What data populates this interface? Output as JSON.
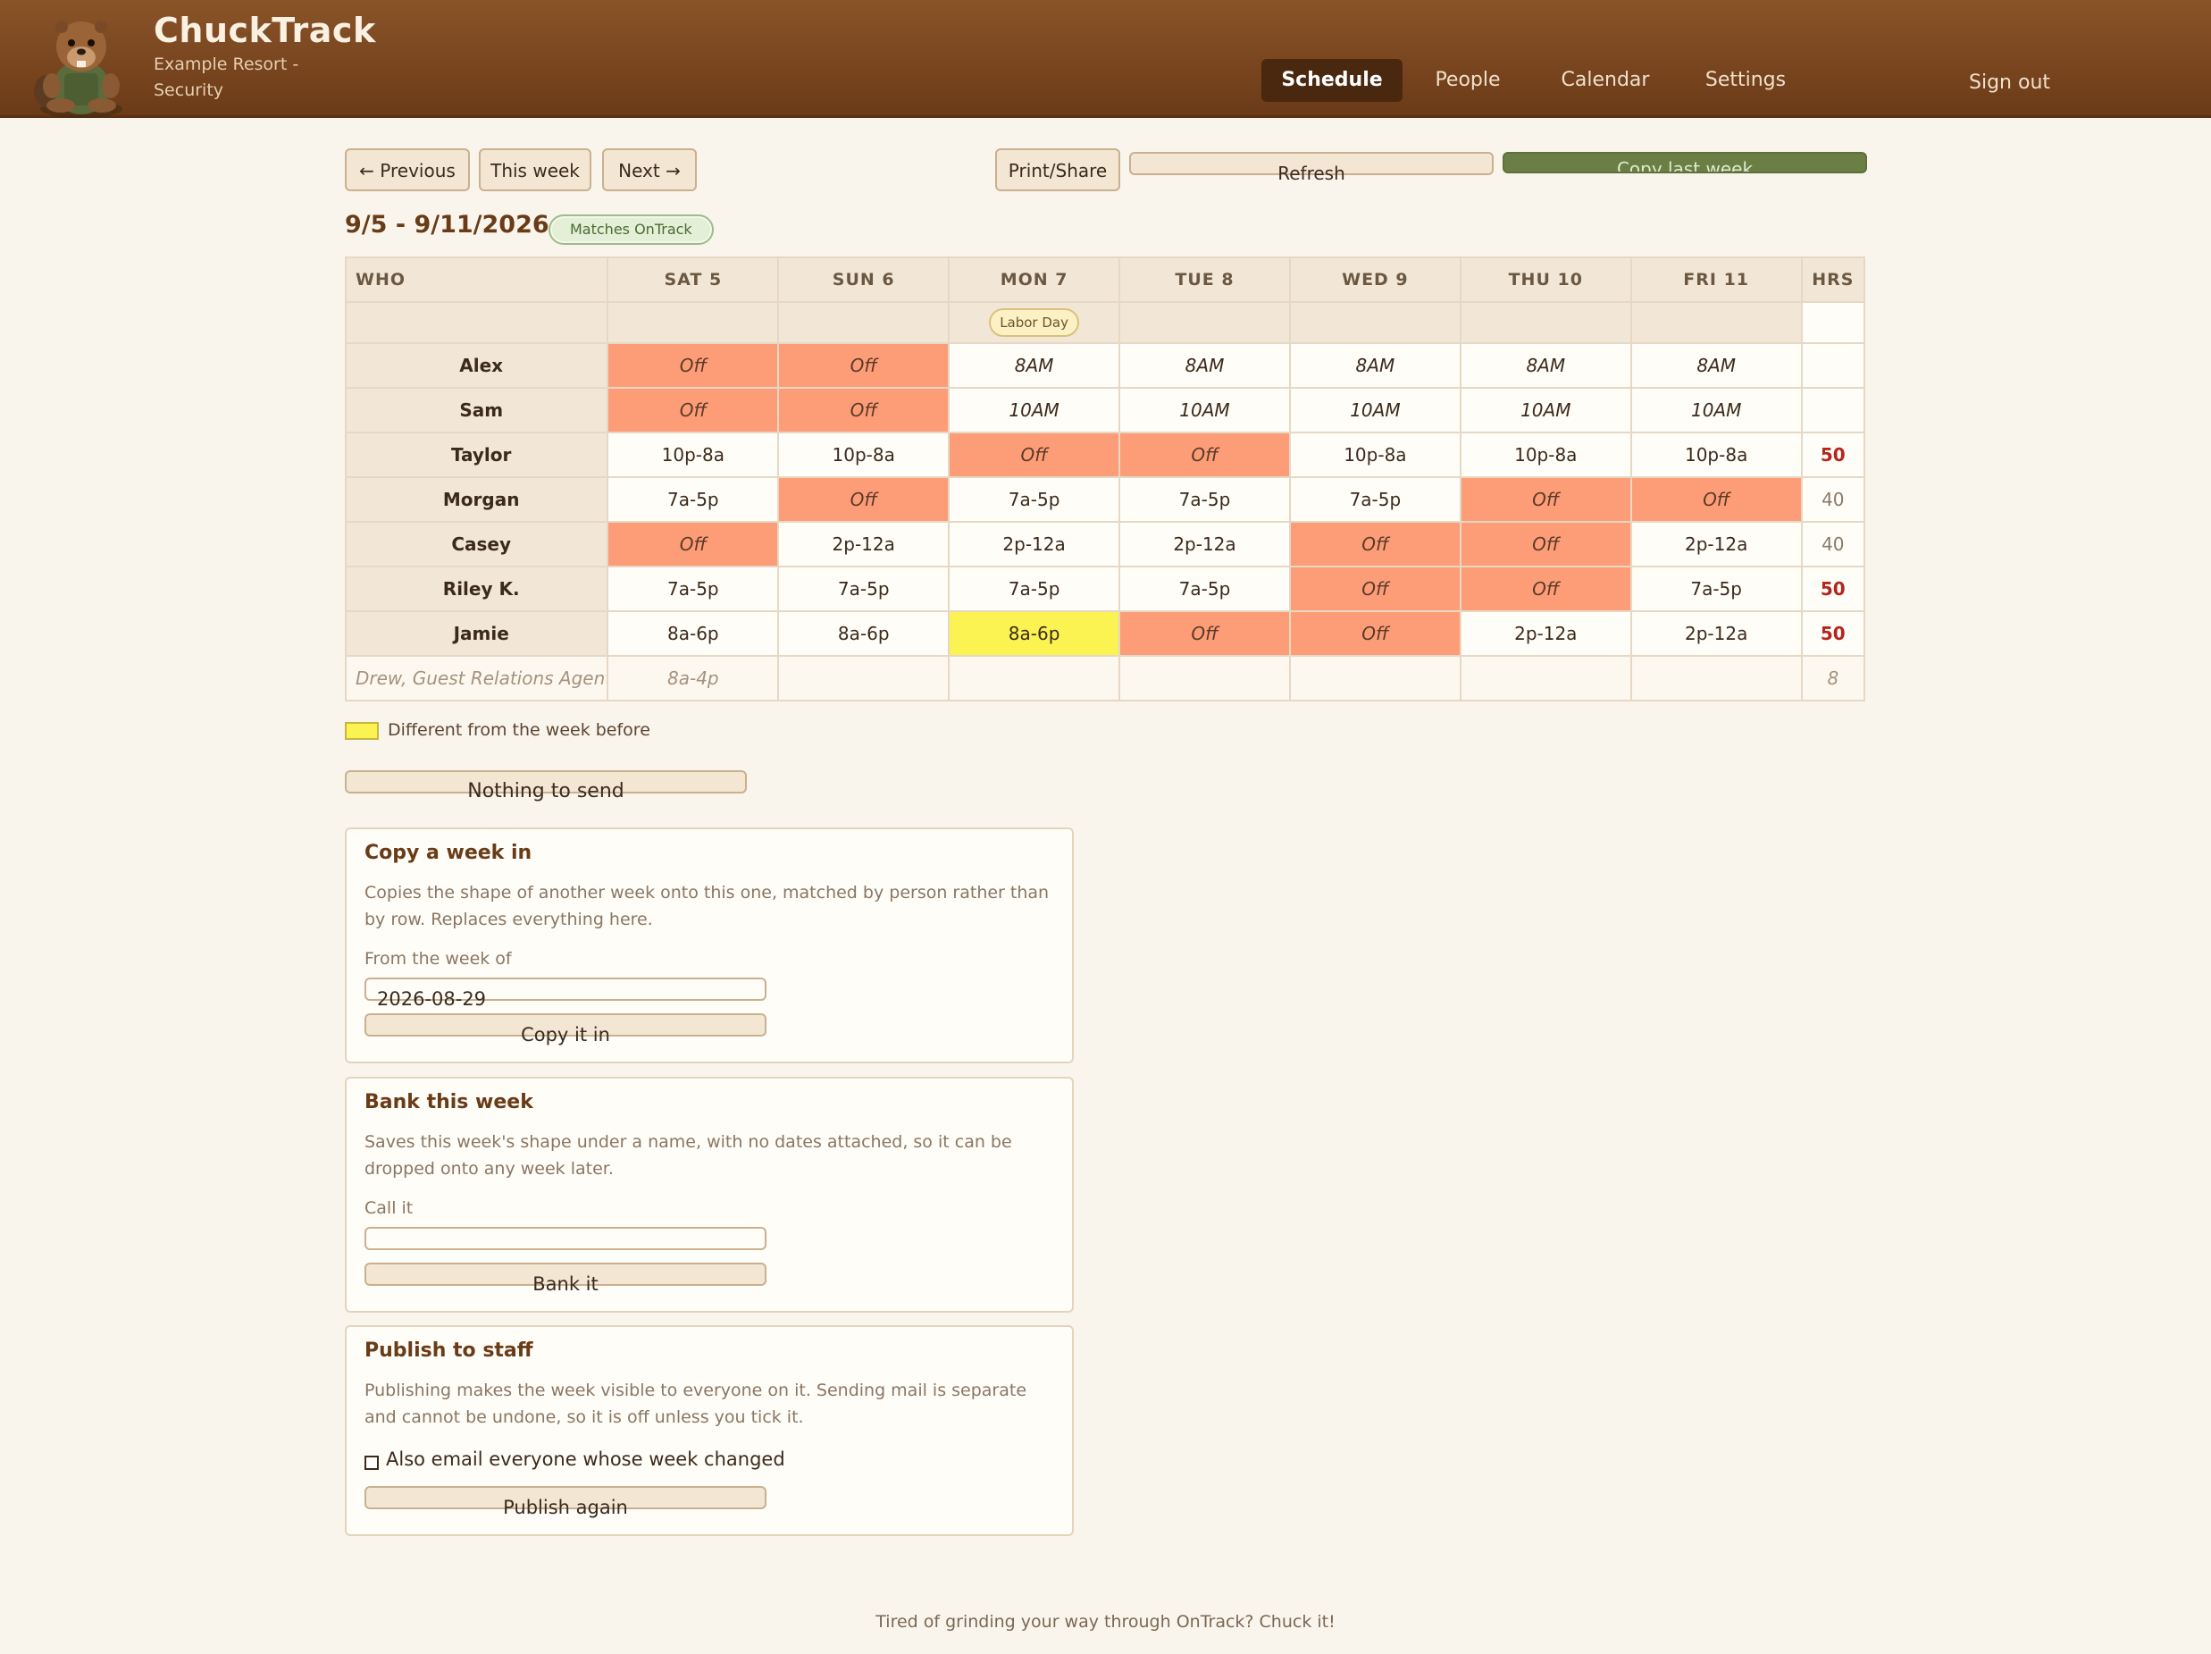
{
  "app": {
    "title": "ChuckTrack",
    "subtitle": "Example Resort - Security"
  },
  "nav": {
    "items": [
      "Schedule",
      "People",
      "Calendar",
      "Settings"
    ],
    "active": "Schedule",
    "sign_out": "Sign out"
  },
  "toolbar": {
    "previous": "← Previous",
    "this_week": "This week",
    "next": "Next →",
    "print_share": "Print/Share",
    "refresh": "Refresh",
    "copy_last_week": "Copy last week"
  },
  "week": {
    "range": "9/5 - 9/11/2026",
    "badge": "Matches OnTrack"
  },
  "table": {
    "headers": [
      "WHO",
      "SAT 5",
      "SUN 6",
      "MON 7",
      "TUE 8",
      "WED 9",
      "THU 10",
      "FRI 11",
      "HRS"
    ],
    "holiday": {
      "day_index": 2,
      "label": "Labor Day"
    },
    "rows": [
      {
        "name": "Alex",
        "cells": [
          "Off",
          "Off",
          "8AM",
          "8AM",
          "8AM",
          "8AM",
          "8AM"
        ],
        "hrs": ""
      },
      {
        "name": "Sam",
        "cells": [
          "Off",
          "Off",
          "10AM",
          "10AM",
          "10AM",
          "10AM",
          "10AM"
        ],
        "hrs": ""
      },
      {
        "name": "Taylor",
        "cells": [
          "10p-8a",
          "10p-8a",
          "Off",
          "Off",
          "10p-8a",
          "10p-8a",
          "10p-8a"
        ],
        "hrs": "50"
      },
      {
        "name": "Morgan",
        "cells": [
          "7a-5p",
          "Off",
          "7a-5p",
          "7a-5p",
          "7a-5p",
          "Off",
          "Off"
        ],
        "hrs": "40"
      },
      {
        "name": "Casey",
        "cells": [
          "Off",
          "2p-12a",
          "2p-12a",
          "2p-12a",
          "Off",
          "Off",
          "2p-12a"
        ],
        "hrs": "40"
      },
      {
        "name": "Riley K.",
        "cells": [
          "7a-5p",
          "7a-5p",
          "7a-5p",
          "7a-5p",
          "Off",
          "Off",
          "7a-5p"
        ],
        "hrs": "50"
      },
      {
        "name": "Jamie",
        "cells": [
          "8a-6p",
          "8a-6p",
          "8a-6p",
          "Off",
          "Off",
          "2p-12a",
          "2p-12a"
        ],
        "hrs": "50"
      }
    ],
    "guest_row": {
      "name": "Drew, Guest Relations Agent",
      "cells": [
        "8a-4p",
        "",
        "",
        "",
        "",
        "",
        ""
      ],
      "hrs": "8"
    }
  },
  "legend": {
    "changed_label": "Different from the week before",
    "changed_color": "#fbf352"
  },
  "nothing_to_send": "Nothing to send",
  "copy_panel": {
    "title": "Copy a week in",
    "description": "Copies the shape of another week onto this one, matched by person rather than by row. Replaces everything here.",
    "label": "From the week of",
    "value": "2026-08-29",
    "button": "Copy it in"
  },
  "bank_panel": {
    "title": "Bank this week",
    "description": "Saves this week's shape under a name, with no dates attached, so it can be dropped onto any week later.",
    "label": "Call it",
    "value": "",
    "button": "Bank it"
  },
  "publish_panel": {
    "title": "Publish to staff",
    "description": "Publishing makes the week visible to everyone on it. Sending mail is separate and cannot be undone, so it is off unless you tick it.",
    "checkbox_label": "Also email everyone whose week changed",
    "checked": false,
    "button": "Publish again"
  },
  "footer": "Tired of grinding your way through OnTrack? Chuck it!",
  "colors": {
    "header": "#7a4520",
    "off_cell": "#fd9d78",
    "changed_cell": "#fbf352",
    "over_hours": "#b3261e",
    "primary_button": "#6b7f45"
  }
}
